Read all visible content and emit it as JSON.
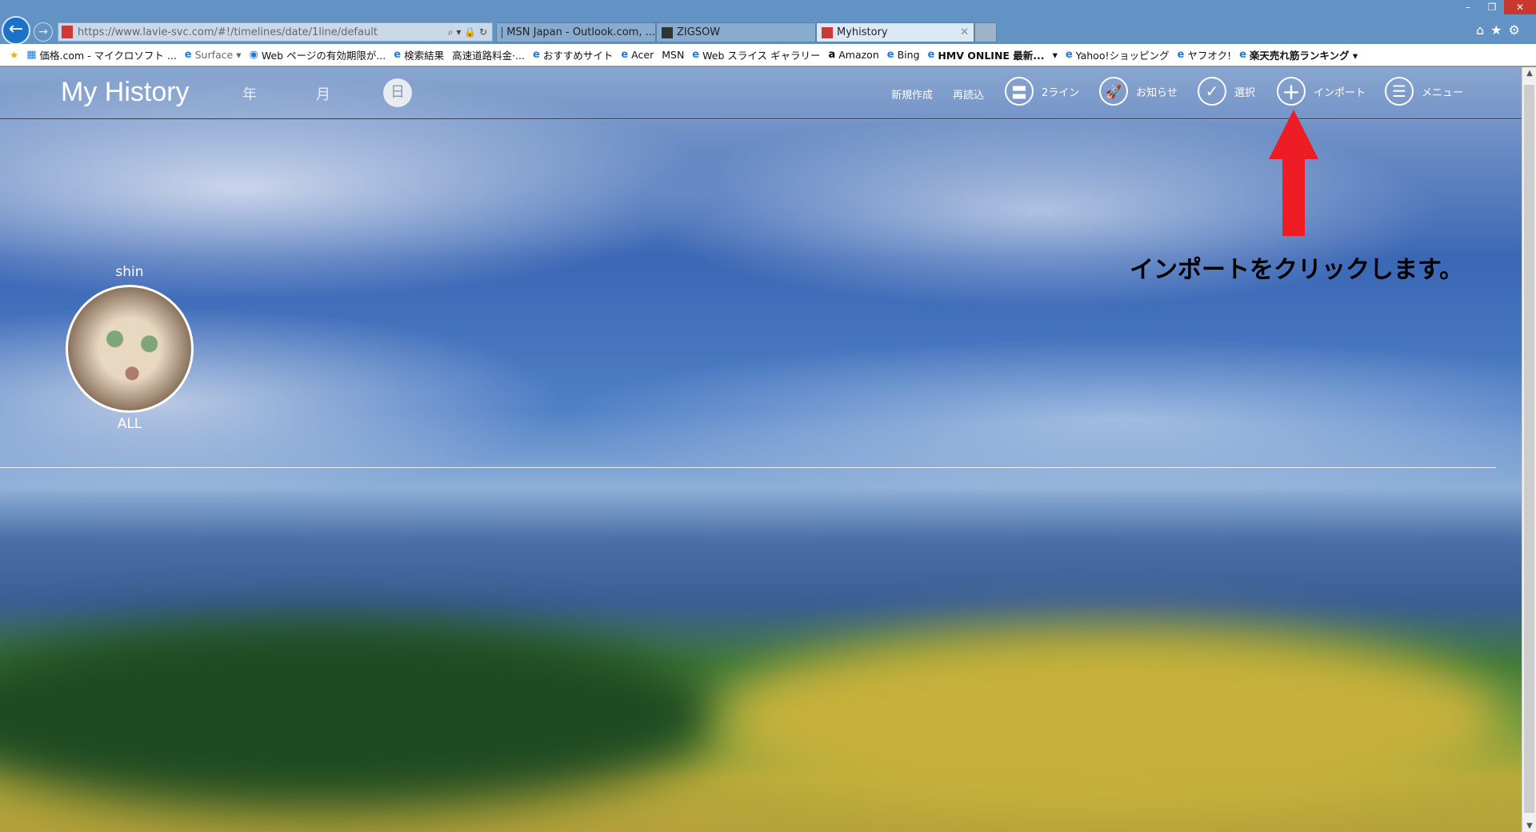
{
  "browser": {
    "url": "https://www.lavie-svc.com/#!/timelines/date/1line/default",
    "tabs": [
      {
        "label": "MSN Japan - Outlook.com, ..."
      },
      {
        "label": "ZIGSOW"
      },
      {
        "label": "Myhistory",
        "active": true
      }
    ],
    "window_controls": [
      "–",
      "❐",
      "✕"
    ],
    "bookmarks": [
      "価格.com - マイクロソフト ...",
      "Surface ▾",
      "Web ページの有効期限が...",
      "検索結果",
      "高速道路料金·...",
      "おすすめサイト",
      "Acer",
      "MSN",
      "Web スライス ギャラリー",
      "Amazon",
      "Bing",
      "HMV ONLINE 最新...",
      "▾",
      "Yahoo!ショッピング",
      "ヤフオク!",
      "楽天売れ筋ランキング ▾"
    ]
  },
  "app": {
    "title": "My History",
    "nav": {
      "year": "年",
      "month": "月",
      "day": "日"
    },
    "menu": [
      {
        "label": "新規作成"
      },
      {
        "label": "再読込"
      },
      {
        "label": "2ライン",
        "icon": "two-lines-icon",
        "glyph": "〓"
      },
      {
        "label": "お知らせ",
        "icon": "rocket-icon",
        "glyph": "🚀"
      },
      {
        "label": "選択",
        "icon": "check-icon",
        "glyph": "✓"
      },
      {
        "label": "インポート",
        "icon": "plus-icon",
        "glyph": "+"
      },
      {
        "label": "メニュー",
        "icon": "list-icon",
        "glyph": "☰"
      }
    ],
    "user": {
      "name": "shin",
      "group": "ALL"
    }
  },
  "annotation": {
    "text": "インポートをクリックします。",
    "arrow_color": "#ee1c24"
  }
}
